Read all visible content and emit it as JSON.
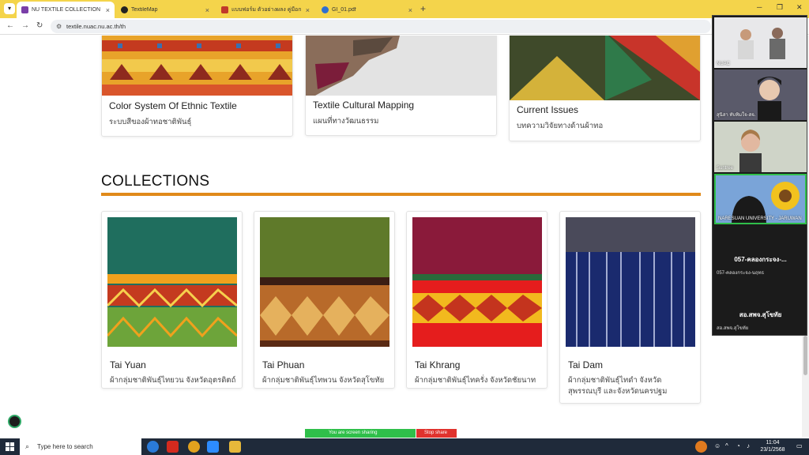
{
  "browser": {
    "tabs": [
      {
        "label": "NU TEXTILE COLLECTION",
        "favicon": "nu-logo",
        "color": "#7a3ea8"
      },
      {
        "label": "TextileMap",
        "favicon": "mapbox-logo",
        "color": "#222222"
      },
      {
        "label": "แบบฟอร์ม ตัวอย่างผลง คู่มือการทอเอ...",
        "favicon": "pdf-logo",
        "color": "#c0392b"
      },
      {
        "label": "GI_01.pdf",
        "favicon": "globe-icon",
        "color": "#2e6fd1"
      }
    ],
    "close_glyph": "×",
    "new_tab_glyph": "+",
    "url": "textile.nuac.nu.ac.th/th"
  },
  "top_cards": [
    {
      "title": "Color System Of Ethnic Textile",
      "subtitle": "ระบบสีของผ้าทอชาติพันธุ์"
    },
    {
      "title": "Textile Cultural Mapping",
      "subtitle": "แผนที่ทางวัฒนธรรม"
    },
    {
      "title": "Current Issues",
      "subtitle": "บทความวิจัยทางด้านผ้าทอ"
    }
  ],
  "collections": {
    "heading": "COLLECTIONS",
    "accent_color": "#e08a1a",
    "items": [
      {
        "name": "Tai Yuan",
        "desc": "ผ้ากลุ่มชาติพันธุ์ไทยวน จังหวัดอุตรดิตถ์"
      },
      {
        "name": "Tai Phuan",
        "desc": "ผ้ากลุ่มชาติพันธุ์ไทพวน จังหวัดสุโขทัย"
      },
      {
        "name": "Tai Khrang",
        "desc": "ผ้ากลุ่มชาติพันธุ์ไทครั่ง จังหวัดชัยนาท"
      },
      {
        "name": "Tai Dam",
        "desc": "ผ้ากลุ่มชาติพันธุ์ไทดำ จังหวัดสุพรรณบุรี และจังหวัดนครปฐม"
      }
    ]
  },
  "zoom": {
    "share_label": "You are screen sharing",
    "stop_label": "Stop share",
    "participants": [
      {
        "name": "NUAC"
      },
      {
        "name": "สุนิสา ทับทิมใจ-สจ."
      },
      {
        "name": "Suntree"
      },
      {
        "name": "NARESUAN UNIVERSITY - JARUWAN"
      }
    ],
    "named_tiles": [
      {
        "big": "057-คลองกระจง-...",
        "small": "057-คลองกระจง-นฤทธ"
      },
      {
        "big": "สอ.สพจ.สุโขทัย",
        "small": "สอ.สพจ.สุโขทัย"
      }
    ]
  },
  "taskbar": {
    "search_placeholder": "Type here to search",
    "time": "11:04",
    "date": "23/1/2568"
  }
}
